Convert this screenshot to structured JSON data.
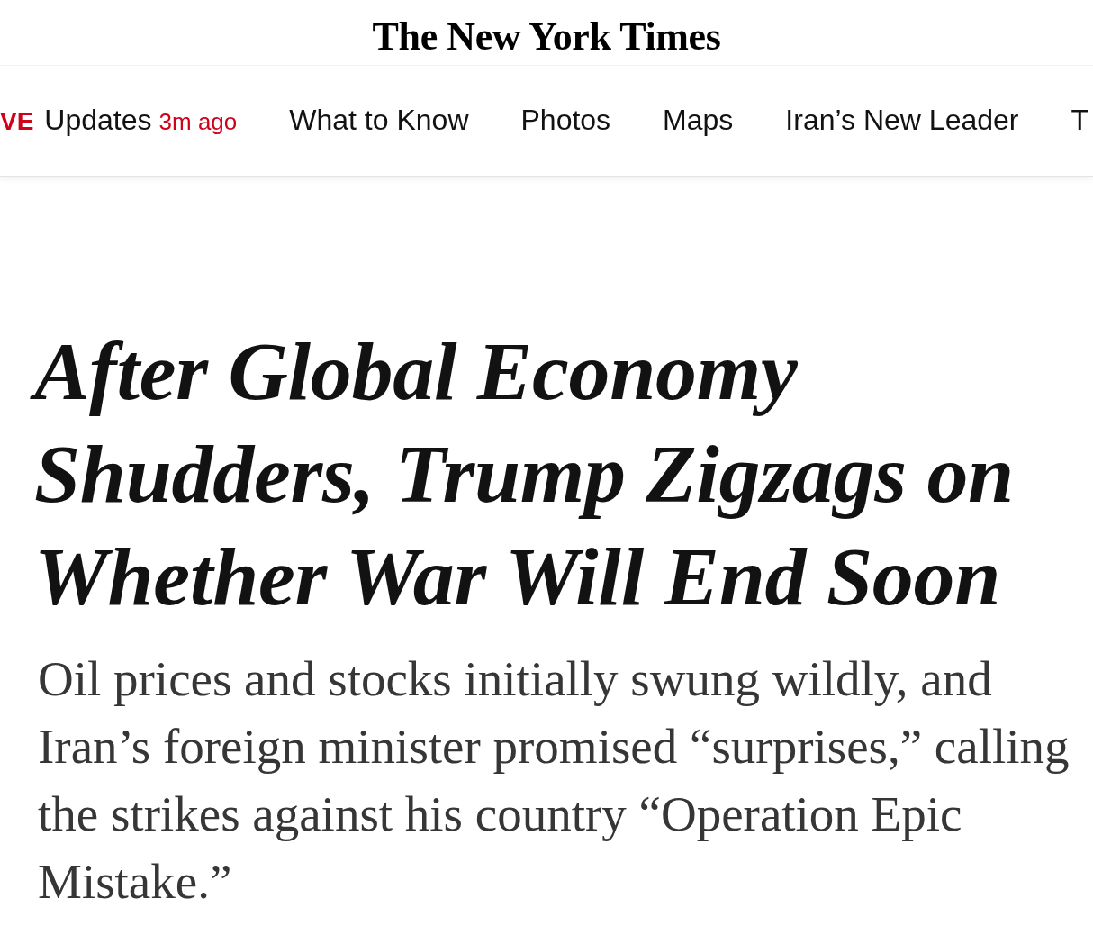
{
  "masthead": {
    "logo": "The New York Times"
  },
  "nav": {
    "items": [
      {
        "kind": "live",
        "live_label": "VE",
        "label": "Updates",
        "time": "3m ago"
      },
      {
        "kind": "link",
        "label": "What to Know"
      },
      {
        "kind": "link",
        "label": "Photos"
      },
      {
        "kind": "link",
        "label": "Maps"
      },
      {
        "kind": "link",
        "label": "Iran’s New Leader"
      },
      {
        "kind": "link",
        "label": "T"
      }
    ]
  },
  "article": {
    "headline": "After Global Economy Shudders, Trump Zigzags on Whether War Will End Soon",
    "summary": "Oil prices and stocks initially swung wildly, and Iran’s foreign minister promised “surprises,” calling the strikes against his country “Operation Epic Mistake.”"
  }
}
